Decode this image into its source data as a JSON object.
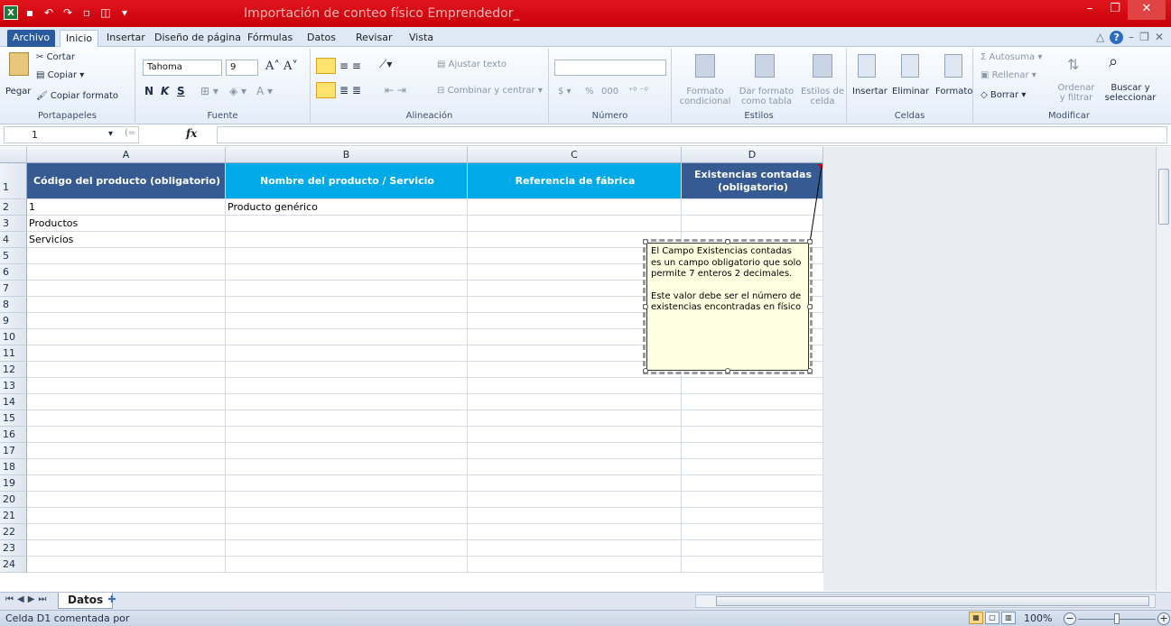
{
  "window": {
    "title": "Importación de conteo físico Emprendedor_",
    "colors": {
      "titlebar": "#d40b14",
      "header_dark": "#365a92",
      "header_light": "#00a9e8",
      "comment_bg": "#ffffe1"
    }
  },
  "ribbon": {
    "tabs": [
      "Archivo",
      "Inicio",
      "Insertar",
      "Diseño de página",
      "Fórmulas",
      "Datos",
      "Revisar",
      "Vista"
    ],
    "active_tab": "Inicio",
    "clipboard": {
      "paste": "Pegar",
      "cut": "Cortar",
      "copy": "Copiar ▾",
      "format_painter": "Copiar formato",
      "label": "Portapapeles"
    },
    "font": {
      "name": "Tahoma",
      "size": "9",
      "bold": "N",
      "italic": "K",
      "underline": "S",
      "label": "Fuente"
    },
    "alignment": {
      "wrap": "Ajustar texto",
      "merge": "Combinar y centrar",
      "label": "Alineación"
    },
    "number": {
      "currency": "$",
      "percent": "%",
      "thousands": "000",
      "label": "Número"
    },
    "styles": {
      "conditional": "Formato condicional",
      "as_table": "Dar formato como tabla",
      "cell_styles": "Estilos de celda",
      "label": "Estilos"
    },
    "cells": {
      "insert": "Insertar",
      "delete": "Eliminar",
      "format": "Formato",
      "label": "Celdas"
    },
    "editing": {
      "autosum": "Autosuma",
      "fill": "Rellenar",
      "clear": "Borrar",
      "sort": "Ordenar y filtrar",
      "find": "Buscar y seleccionar",
      "label": "Modificar"
    }
  },
  "formula_bar": {
    "name_box": "1",
    "fx": "fx",
    "value": ""
  },
  "sheet": {
    "columns": [
      "A",
      "B",
      "C",
      "D"
    ],
    "headers": [
      "Código del producto (obligatorio)",
      "Nombre del producto / Servicio",
      "Referencia de fábrica",
      "Existencias contadas (obligatorio)"
    ],
    "rows": [
      {
        "n": "2",
        "cells": [
          "1",
          "Producto genérico",
          "",
          ""
        ]
      },
      {
        "n": "3",
        "cells": [
          "Productos",
          "",
          "",
          ""
        ]
      },
      {
        "n": "4",
        "cells": [
          "Servicios",
          "",
          "",
          ""
        ]
      },
      {
        "n": "5",
        "cells": [
          "",
          "",
          "",
          ""
        ]
      },
      {
        "n": "6",
        "cells": [
          "",
          "",
          "",
          ""
        ]
      },
      {
        "n": "7",
        "cells": [
          "",
          "",
          "",
          ""
        ]
      },
      {
        "n": "8",
        "cells": [
          "",
          "",
          "",
          ""
        ]
      },
      {
        "n": "9",
        "cells": [
          "",
          "",
          "",
          ""
        ]
      },
      {
        "n": "10",
        "cells": [
          "",
          "",
          "",
          ""
        ]
      },
      {
        "n": "11",
        "cells": [
          "",
          "",
          "",
          ""
        ]
      },
      {
        "n": "12",
        "cells": [
          "",
          "",
          "",
          ""
        ]
      },
      {
        "n": "13",
        "cells": [
          "",
          "",
          "",
          ""
        ]
      },
      {
        "n": "14",
        "cells": [
          "",
          "",
          "",
          ""
        ]
      },
      {
        "n": "15",
        "cells": [
          "",
          "",
          "",
          ""
        ]
      },
      {
        "n": "16",
        "cells": [
          "",
          "",
          "",
          ""
        ]
      },
      {
        "n": "17",
        "cells": [
          "",
          "",
          "",
          ""
        ]
      },
      {
        "n": "18",
        "cells": [
          "",
          "",
          "",
          ""
        ]
      },
      {
        "n": "19",
        "cells": [
          "",
          "",
          "",
          ""
        ]
      },
      {
        "n": "20",
        "cells": [
          "",
          "",
          "",
          ""
        ]
      },
      {
        "n": "21",
        "cells": [
          "",
          "",
          "",
          ""
        ]
      },
      {
        "n": "22",
        "cells": [
          "",
          "",
          "",
          ""
        ]
      },
      {
        "n": "23",
        "cells": [
          "",
          "",
          "",
          ""
        ]
      },
      {
        "n": "24",
        "cells": [
          "",
          "",
          "",
          ""
        ]
      }
    ],
    "comment": {
      "para1": "El Campo Existencias contadas es un campo obligatorio que solo permite 7 enteros 2 decimales.",
      "para2": "Este valor debe ser el número de existencias encontradas en físico"
    },
    "sheet_tab": "Datos"
  },
  "status_bar": {
    "message": "Celda D1 comentada por",
    "zoom": "100%"
  }
}
